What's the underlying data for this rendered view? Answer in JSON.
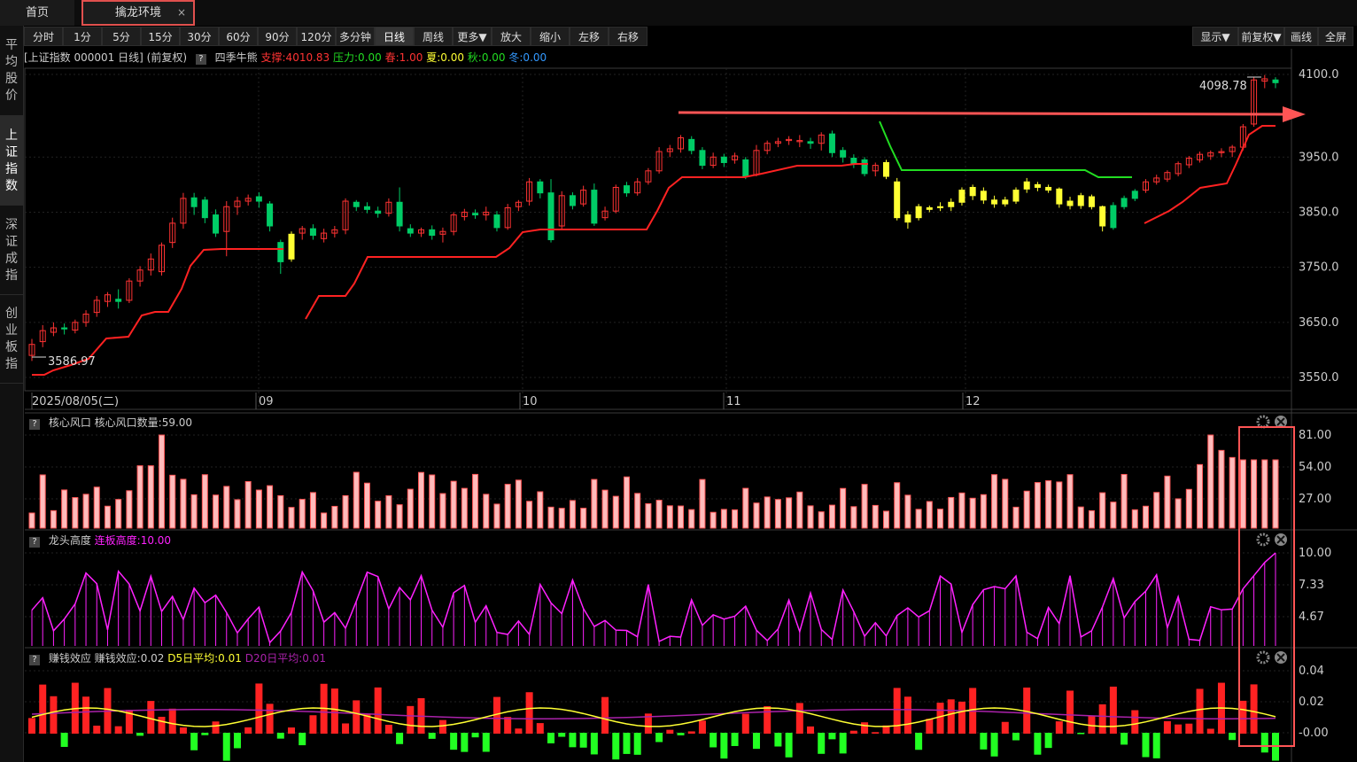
{
  "tabs": {
    "home": "首页",
    "active": "擒龙环境",
    "close": "×"
  },
  "sidebar": [
    {
      "label": "平均股价",
      "active": false
    },
    {
      "label": "上证指数",
      "active": true
    },
    {
      "label": "深证成指",
      "active": false
    },
    {
      "label": "创业板指",
      "active": false
    }
  ],
  "toolbar": {
    "left": [
      "分时",
      "1分",
      "5分",
      "15分",
      "30分",
      "60分",
      "90分",
      "120分",
      "多分钟",
      "日线",
      "周线",
      "更多▼",
      "放大",
      "缩小",
      "左移",
      "右移"
    ],
    "active": "日线",
    "right": [
      "显示▼",
      "前复权▼",
      "画线",
      "全屏"
    ]
  },
  "info": {
    "title": "[上证指数 000001 日线]",
    "adjust": "(前复权)",
    "q": "?",
    "indicator": "四季牛熊",
    "support": "支撑:4010.83",
    "pressure": "压力:0.00",
    "spring": "春:1.00",
    "summer": "夏:0.00",
    "autumn": "秋:0.00",
    "winter": "冬:0.00"
  },
  "colors": {
    "up": "#ff3333",
    "down": "#00cc66",
    "support_line": "#ff2222",
    "pressure_line": "#22dd22",
    "annotation": "#ff5555",
    "magenta": "#ff22ff",
    "yellow": "#ffff33"
  },
  "main_chart": {
    "y_ticks": [
      "4100.0",
      "3950.0",
      "3850.0",
      "3750.0",
      "3650.0",
      "3550.0"
    ],
    "x_ticks": [
      "2025/08/05(二)",
      "09",
      "10",
      "11",
      "12"
    ],
    "max_label": "4098.78",
    "min_label": "3586.97"
  },
  "panels": [
    {
      "name": "核心风口",
      "label": "核心风口数量:59.00",
      "y_ticks": [
        "81.00",
        "54.00",
        "27.00"
      ]
    },
    {
      "name": "龙头高度",
      "label": "连板高度:10.00",
      "y_ticks": [
        "10.00",
        "7.33",
        "4.67"
      ]
    },
    {
      "name": "赚钱效应",
      "label": "赚钱效应:0.02",
      "d5": "D5日平均:0.01",
      "d20": "D20日平均:0.01",
      "y_ticks": [
        "0.04",
        "0.02",
        "-0.00"
      ]
    }
  ],
  "chart_data": {
    "type": "candlestick",
    "xlabel": "",
    "ylabel": "",
    "ylim": [
      3550,
      4100
    ],
    "candles": [
      [
        3590,
        3610,
        3580,
        3620
      ],
      [
        3615,
        3635,
        3605,
        3645
      ],
      [
        3632,
        3640,
        3625,
        3650
      ],
      [
        3640,
        3638,
        3628,
        3648
      ],
      [
        3636,
        3650,
        3630,
        3655
      ],
      [
        3650,
        3665,
        3642,
        3672
      ],
      [
        3668,
        3690,
        3660,
        3698
      ],
      [
        3688,
        3700,
        3678,
        3705
      ],
      [
        3692,
        3688,
        3675,
        3710
      ],
      [
        3690,
        3725,
        3685,
        3730
      ],
      [
        3725,
        3745,
        3715,
        3752
      ],
      [
        3745,
        3765,
        3735,
        3775
      ],
      [
        3742,
        3790,
        3735,
        3795
      ],
      [
        3795,
        3830,
        3785,
        3840
      ],
      [
        3830,
        3875,
        3820,
        3885
      ],
      [
        3876,
        3860,
        3845,
        3885
      ],
      [
        3872,
        3840,
        3830,
        3878
      ],
      [
        3845,
        3812,
        3805,
        3855
      ],
      [
        3815,
        3860,
        3770,
        3870
      ],
      [
        3860,
        3870,
        3845,
        3878
      ],
      [
        3870,
        3875,
        3862,
        3882
      ],
      [
        3878,
        3870,
        3858,
        3886
      ],
      [
        3865,
        3825,
        3815,
        3870
      ],
      [
        3795,
        3760,
        3738,
        3800
      ],
      [
        3765,
        3810,
        3760,
        3815
      ],
      [
        3812,
        3820,
        3800,
        3825
      ],
      [
        3820,
        3808,
        3800,
        3828
      ],
      [
        3802,
        3812,
        3795,
        3820
      ],
      [
        3812,
        3818,
        3804,
        3825
      ],
      [
        3818,
        3870,
        3810,
        3875
      ],
      [
        3868,
        3860,
        3852,
        3872
      ],
      [
        3860,
        3855,
        3848,
        3868
      ],
      [
        3852,
        3848,
        3840,
        3860
      ],
      [
        3848,
        3868,
        3842,
        3875
      ],
      [
        3868,
        3825,
        3815,
        3895
      ],
      [
        3820,
        3812,
        3805,
        3828
      ],
      [
        3812,
        3818,
        3805,
        3822
      ],
      [
        3818,
        3808,
        3800,
        3826
      ],
      [
        3810,
        3815,
        3795,
        3822
      ],
      [
        3815,
        3845,
        3808,
        3850
      ],
      [
        3842,
        3850,
        3835,
        3856
      ],
      [
        3848,
        3845,
        3838,
        3855
      ],
      [
        3845,
        3850,
        3835,
        3860
      ],
      [
        3845,
        3822,
        3815,
        3852
      ],
      [
        3822,
        3858,
        3818,
        3865
      ],
      [
        3860,
        3868,
        3852,
        3872
      ],
      [
        3870,
        3905,
        3862,
        3912
      ],
      [
        3905,
        3885,
        3875,
        3910
      ],
      [
        3885,
        3800,
        3795,
        3910
      ],
      [
        3825,
        3880,
        3820,
        3888
      ],
      [
        3880,
        3862,
        3855,
        3886
      ],
      [
        3865,
        3890,
        3860,
        3898
      ],
      [
        3890,
        3830,
        3825,
        3902
      ],
      [
        3840,
        3852,
        3835,
        3860
      ],
      [
        3852,
        3895,
        3848,
        3900
      ],
      [
        3898,
        3885,
        3878,
        3905
      ],
      [
        3885,
        3905,
        3880,
        3912
      ],
      [
        3905,
        3925,
        3900,
        3930
      ],
      [
        3925,
        3960,
        3920,
        3968
      ],
      [
        3960,
        3965,
        3950,
        3972
      ],
      [
        3965,
        3985,
        3958,
        3990
      ],
      [
        3982,
        3962,
        3955,
        3988
      ],
      [
        3962,
        3935,
        3928,
        3968
      ],
      [
        3935,
        3950,
        3930,
        3958
      ],
      [
        3950,
        3940,
        3932,
        3956
      ],
      [
        3945,
        3952,
        3938,
        3958
      ],
      [
        3945,
        3915,
        3910,
        3950
      ],
      [
        3918,
        3962,
        3915,
        3972
      ],
      [
        3962,
        3975,
        3955,
        3980
      ],
      [
        3975,
        3978,
        3968,
        3985
      ],
      [
        3980,
        3982,
        3972,
        3988
      ],
      [
        3978,
        3980,
        3968,
        3990
      ],
      [
        3978,
        3975,
        3965,
        3985
      ],
      [
        3975,
        3990,
        3962,
        3995
      ],
      [
        3992,
        3958,
        3950,
        3998
      ],
      [
        3962,
        3950,
        3940,
        3968
      ],
      [
        3948,
        3938,
        3930,
        3955
      ],
      [
        3945,
        3920,
        3915,
        3950
      ],
      [
        3925,
        3935,
        3915,
        3940
      ],
      [
        3940,
        3915,
        3910,
        3945
      ],
      [
        3905,
        3840,
        3835,
        3912
      ],
      [
        3845,
        3832,
        3820,
        3852
      ],
      [
        3840,
        3860,
        3835,
        3865
      ],
      [
        3855,
        3858,
        3850,
        3862
      ],
      [
        3858,
        3860,
        3852,
        3868
      ],
      [
        3860,
        3868,
        3852,
        3875
      ],
      [
        3868,
        3890,
        3862,
        3895
      ],
      [
        3895,
        3880,
        3872,
        3900
      ],
      [
        3888,
        3872,
        3865,
        3895
      ],
      [
        3872,
        3865,
        3858,
        3880
      ],
      [
        3865,
        3872,
        3860,
        3878
      ],
      [
        3870,
        3890,
        3865,
        3895
      ],
      [
        3892,
        3905,
        3885,
        3912
      ],
      [
        3900,
        3895,
        3888,
        3905
      ],
      [
        3895,
        3890,
        3885,
        3900
      ],
      [
        3892,
        3865,
        3858,
        3895
      ],
      [
        3870,
        3862,
        3855,
        3878
      ],
      [
        3862,
        3880,
        3856,
        3885
      ],
      [
        3878,
        3860,
        3855,
        3882
      ],
      [
        3860,
        3825,
        3815,
        3862
      ],
      [
        3822,
        3862,
        3818,
        3868
      ],
      [
        3860,
        3875,
        3855,
        3880
      ],
      [
        3875,
        3888,
        3870,
        3892
      ],
      [
        3890,
        3905,
        3885,
        3910
      ],
      [
        3905,
        3912,
        3900,
        3918
      ],
      [
        3910,
        3922,
        3905,
        3926
      ],
      [
        3920,
        3938,
        3915,
        3942
      ],
      [
        3936,
        3948,
        3930,
        3952
      ],
      [
        3945,
        3955,
        3940,
        3960
      ],
      [
        3952,
        3958,
        3945,
        3962
      ],
      [
        3958,
        3960,
        3950,
        3966
      ],
      [
        3960,
        3968,
        3950,
        3972
      ],
      [
        3968,
        4005,
        3962,
        4010
      ],
      [
        4010,
        4090,
        4005,
        4095
      ],
      [
        4088,
        4092,
        4075,
        4099
      ],
      [
        4090,
        4085,
        4075,
        4095
      ]
    ]
  }
}
